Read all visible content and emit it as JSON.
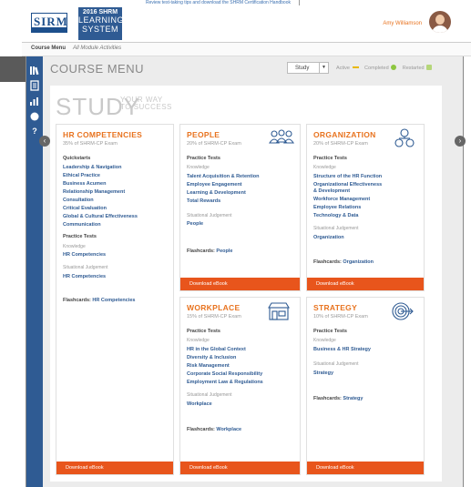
{
  "top_note": "Review test-taking tips and download the SHRM Certification Handbook",
  "header": {
    "logo_sirm": "SIRM",
    "logo_year": "2016 SHRM",
    "logo_line1": "LEARNING",
    "logo_line2": "SYSTEM",
    "user_name": "Amy Williamson"
  },
  "subnav": {
    "course_menu": "Course Menu",
    "all_activities": "All Module Activities"
  },
  "sidebar": {
    "icons": [
      "book-stack-icon",
      "document-icon",
      "bar-chart-icon",
      "circle-icon",
      "help-icon"
    ],
    "help_glyph": "?"
  },
  "main": {
    "title": "COURSE MENU",
    "study_select": "Study",
    "study_arrow": "▼",
    "legend": {
      "active": "Active",
      "completed": "Completed",
      "restarted": "Restarted"
    },
    "study_word": "STUDY",
    "tag_line1": "YOUR WAY",
    "tag_line2": "TO SUCCESS",
    "prev_arrow": "‹",
    "next_arrow": "›"
  },
  "colors": {
    "accent": "#e8731f",
    "footer": "#e8551c",
    "brand_blue": "#2f5b93",
    "legend_active": "#e8b800",
    "legend_completed": "#8dc63f",
    "legend_restarted": "#b5d67a"
  },
  "cards": {
    "hr": {
      "title": "HR COMPETENCIES",
      "sub": "35% of SHRM-CP Exam",
      "quickstarts_label": "Quickstarts",
      "quickstarts": [
        "Leadership & Navigation",
        "Ethical Practice",
        "Business Acumen",
        "Relationship Management",
        "Consultation",
        "Critical Evaluation",
        "Global & Cultural Effectiveness",
        "Communication"
      ],
      "practice_label": "Practice Tests",
      "knowledge_label": "Knowledge",
      "knowledge_link": "HR Competencies",
      "sj_label": "Situational Judgement",
      "sj_link": "HR Competencies",
      "flash_label": "Flashcards:",
      "flash_link": "HR Competencies",
      "footer": "Download eBook"
    },
    "people": {
      "title": "PEOPLE",
      "sub": "20% of SHRM-CP Exam",
      "practice_label": "Practice Tests",
      "knowledge_label": "Knowledge",
      "knowledge_links": [
        "Talent Acquisition & Retention",
        "Employee Engagement",
        "Learning & Development",
        "Total Rewards"
      ],
      "sj_label": "Situational Judgement",
      "sj_link": "People",
      "flash_label": "Flashcards:",
      "flash_link": "People",
      "footer": "Download eBook",
      "icon": "people-group-icon"
    },
    "org": {
      "title": "ORGANIZATION",
      "sub": "20% of SHRM-CP Exam",
      "practice_label": "Practice Tests",
      "knowledge_label": "Knowledge",
      "knowledge_links": [
        "Structure of the HR Function",
        "Organizational Effectiveness",
        "& Development",
        "Workforce Management",
        "Employee Relations",
        "Technology & Data"
      ],
      "sj_label": "Situational Judgement",
      "sj_link": "Organization",
      "flash_label": "Flashcards:",
      "flash_link": "Organization",
      "footer": "Download eBook",
      "icon": "org-chart-icon"
    },
    "workplace": {
      "title": "WORKPLACE",
      "sub": "15% of SHRM-CP Exam",
      "practice_label": "Practice Tests",
      "knowledge_label": "Knowledge",
      "knowledge_links": [
        "HR in the Global Context",
        "Diversity & Inclusion",
        "Risk Management",
        "Corporate Social Responsibility",
        "Employment Law & Regulations"
      ],
      "sj_label": "Situational Judgement",
      "sj_link": "Workplace",
      "flash_label": "Flashcards:",
      "flash_link": "Workplace",
      "footer": "Download eBook",
      "icon": "storefront-icon"
    },
    "strategy": {
      "title": "STRATEGY",
      "sub": "10% of SHRM-CP Exam",
      "practice_label": "Practice Tests",
      "knowledge_label": "Knowledge",
      "knowledge_link": "Business & HR Strategy",
      "sj_label": "Situational Judgement",
      "sj_link": "Strategy",
      "flash_label": "Flashcards:",
      "flash_link": "Strategy",
      "footer": "Download eBook",
      "icon": "target-icon"
    }
  }
}
